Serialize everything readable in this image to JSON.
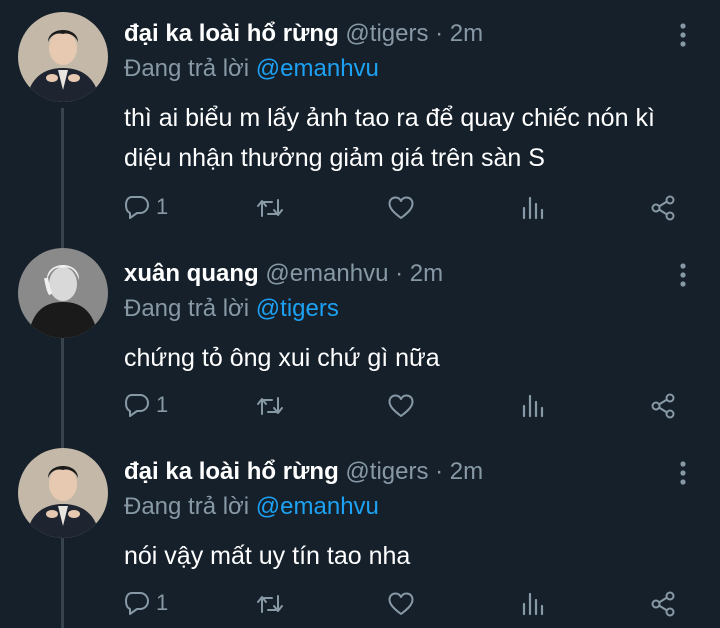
{
  "colors": {
    "background": "#15202b",
    "secondary_text": "#8899a6",
    "accent": "#1da1f2",
    "thread_line": "#38444d"
  },
  "tweets": [
    {
      "display_name": "đại ka loài hổ rừng",
      "handle_time": "@tigers · 2m",
      "replying_prefix": "Đang trả lời",
      "replying_to": "@emanhvu",
      "text": "thì ai biểu m lấy ảnh tao ra để quay chiếc nón kì diệu nhận thưởng giảm giá trên sàn S",
      "reply_count": "1"
    },
    {
      "display_name": "xuân quang",
      "handle_time": "@emanhvu · 2m",
      "replying_prefix": "Đang trả lời",
      "replying_to": "@tigers",
      "text": "chứng tỏ ông xui chứ gì nữa",
      "reply_count": "1"
    },
    {
      "display_name": "đại ka loài hổ rừng",
      "handle_time": "@tigers · 2m",
      "replying_prefix": "Đang trả lời",
      "replying_to": "@emanhvu",
      "text": "nói vậy mất uy tín tao nha",
      "reply_count": "1"
    }
  ],
  "icons": {
    "reply": "reply-icon",
    "retweet": "retweet-icon",
    "like": "heart-icon",
    "analytics": "analytics-icon",
    "share": "share-icon",
    "more": "more-options-icon"
  }
}
